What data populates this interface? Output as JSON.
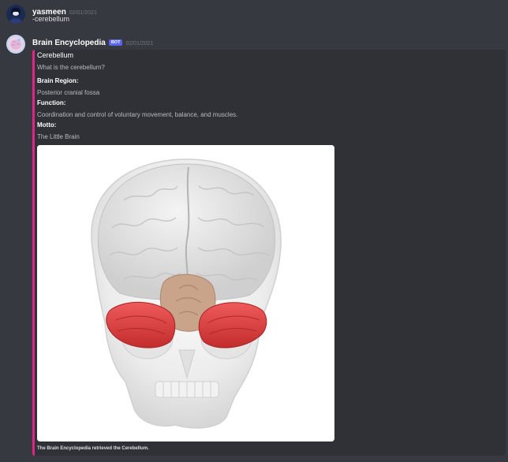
{
  "messages": [
    {
      "author": "yasmeen",
      "timestamp": "02/01/2021",
      "content": "-cerebellum",
      "avatar_icon": "user-avatar-icon"
    },
    {
      "author": "Brain Encyclopedia",
      "bot_tag": "BOT",
      "timestamp": "02/01/2021",
      "avatar_icon": "bot-avatar-icon",
      "embed": {
        "accent_color": "#e22389",
        "title": "Cerebellum",
        "description": "What is the cerebellum?",
        "fields": [
          {
            "name": "Brain Region:",
            "value": "Posterior cranial fossa"
          },
          {
            "name": "Function:",
            "value": "Coordination and control of voluntary movement, balance, and muscles."
          },
          {
            "name": "Motto:",
            "value": "The Little Brain"
          }
        ],
        "image": "skull-brain-cerebellum-highlight",
        "footer": "The Brain Encyclopedia retrieved the Cerebellum."
      }
    }
  ],
  "colors": {
    "background": "#36393f",
    "embed_background": "#2f3136",
    "bot_tag": "#5865f2",
    "cerebellum": "#d93a3a"
  }
}
